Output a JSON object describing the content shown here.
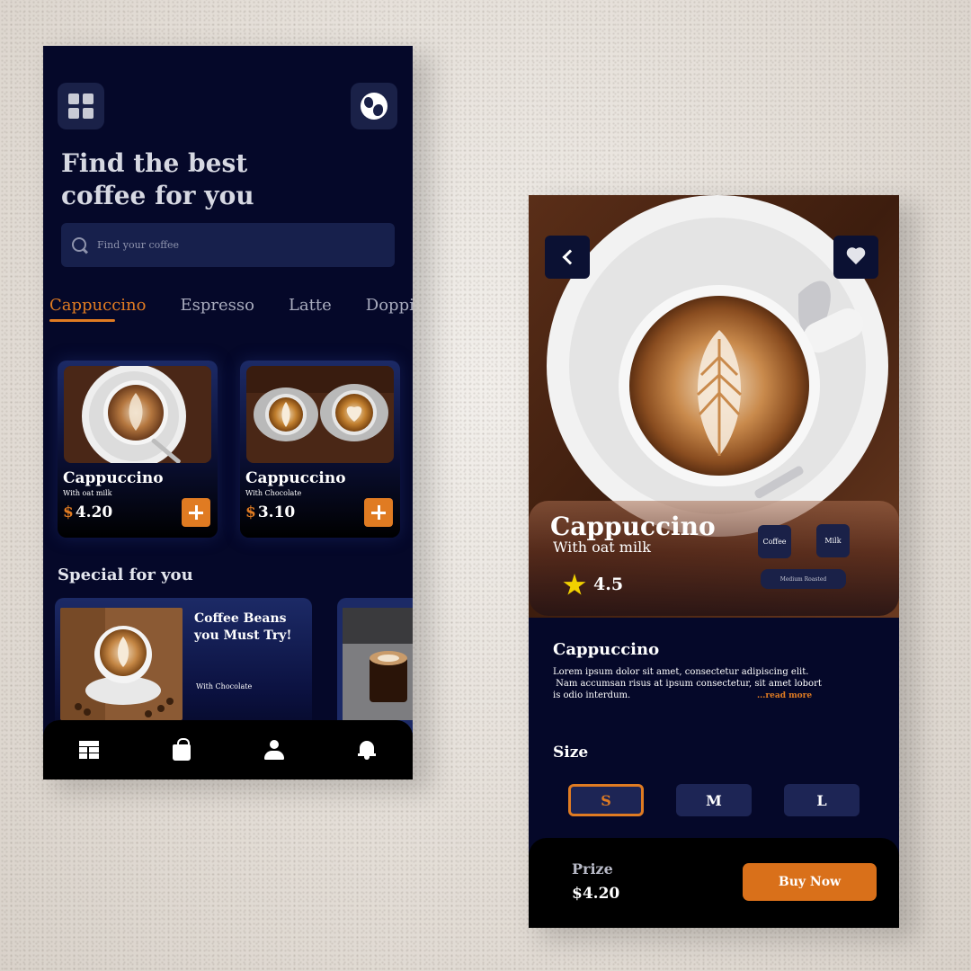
{
  "home": {
    "headline_line1": "Find the best",
    "headline_line2": "coffee for you",
    "search_placeholder": "Find your coffee",
    "tabs": [
      {
        "label": "Cappuccino",
        "active": true
      },
      {
        "label": "Espresso",
        "active": false
      },
      {
        "label": "Latte",
        "active": false
      },
      {
        "label": "Doppio",
        "active": false
      }
    ],
    "products": [
      {
        "name": "Cappuccino",
        "sub": "With oat milk",
        "currency": "$",
        "price": "4.20"
      },
      {
        "name": "Cappuccino",
        "sub": "With Chocolate",
        "currency": "$",
        "price": "3.10"
      }
    ],
    "special_title": "Special for you",
    "special": {
      "title": "Coffee Beans you Must Try!",
      "sub": "With Chocolate"
    },
    "nav": [
      "home-icon",
      "bag-icon",
      "user-icon",
      "bell-icon"
    ]
  },
  "detail": {
    "title": "Cappuccino",
    "subtitle": "With oat milk",
    "rating": "4.5",
    "chips": [
      "Coffee",
      "Milk"
    ],
    "roast": "Medium Roasted",
    "desc_title": "Cappuccino",
    "desc_line1": "Lorem ipsum dolor sit amet, consectetur adipiscing elit.",
    "desc_line2": " Nam accumsan risus at ipsum consectetur, sit amet lobort",
    "desc_line3": "is odio interdum.",
    "read_more": "...read more",
    "size_title": "Size",
    "sizes": [
      {
        "label": "S",
        "active": true
      },
      {
        "label": "M",
        "active": false
      },
      {
        "label": "L",
        "active": false
      }
    ],
    "prize_label": "Prize",
    "prize_value": "$4.20",
    "buy_label": "Buy Now"
  },
  "colors": {
    "background": "#050829",
    "accent": "#e07b22",
    "card": "#1a2148",
    "star": "#f1d100"
  }
}
